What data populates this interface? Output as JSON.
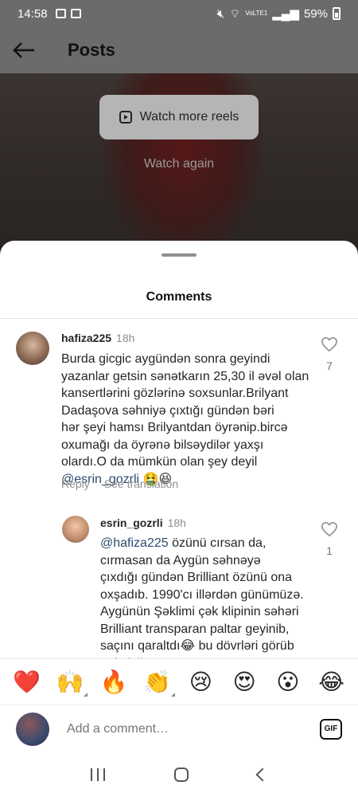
{
  "status_bar": {
    "time": "14:58",
    "network_label": "VoLTE1",
    "battery": "59%"
  },
  "header": {
    "title": "Posts"
  },
  "video": {
    "watch_more_label": "Watch more reels",
    "watch_again_label": "Watch again"
  },
  "sheet": {
    "title": "Comments"
  },
  "comments": [
    {
      "username": "hafiza225",
      "time": "18h",
      "text_lines": [
        "Burda gicgic aygündən sonra geyindi",
        "yazanlar getsin sənətkarın 25,30 il əvəl olan",
        "kansertlərini gözlərinə soxsunlar.Brilyant",
        "Dadaşova səhniyə çıxtığı gündən bəri",
        "hər şeyi hamsı Brilyantdan öyrənip.bircə",
        "oxumağı da öyrənə bilsəydilər yaxşı",
        "olardı.O da mümkün olan şey deyil"
      ],
      "mention": "@esrin_gozrli",
      "emoji_suffix": "🤮😆",
      "reply_label": "Reply",
      "translate_label": "See translation",
      "likes": "7"
    },
    {
      "username": "esrin_gozrli",
      "time": "18h",
      "mention": "@hafiza225",
      "first_line_rest": " özünü cırsan da,",
      "text_lines": [
        "cırmasan da Aygün səhnəyə",
        "çıxdığı gündən Brilliant özünü ona",
        "oxşadıb. 1990'cı illərdən günümüzə.",
        "Aygünün Şəklimi çək klipinin səhəri",
        "Brilliant transparan paltar geyinib,",
        "saçını qaraltdı😂 bu dövrləri görüb",
        "gəlmişik"
      ],
      "likes": "1"
    }
  ],
  "emoji_bar": [
    "❤️",
    "🙌",
    "🔥",
    "👏",
    "😢",
    "😍",
    "😮",
    "😂"
  ],
  "input": {
    "placeholder": "Add a comment…",
    "gif_label": "GIF"
  }
}
